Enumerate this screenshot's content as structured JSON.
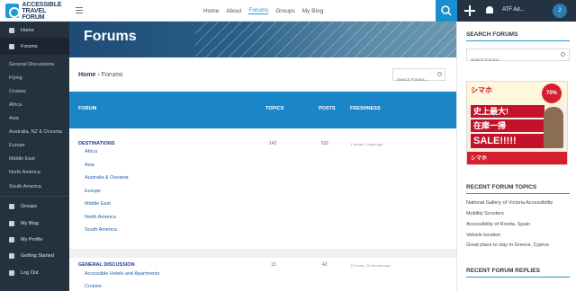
{
  "brand": {
    "name_line1": "ACCESSIBLE",
    "name_line2": "TRAVEL FORUM"
  },
  "topnav": {
    "home": "Home",
    "about": "About",
    "forums": "Forums",
    "groups": "Groups",
    "myblog": "My Blog"
  },
  "account": {
    "user_name": "ATF Ad...",
    "avatar_badge": "2"
  },
  "sidebar": {
    "home": "Home",
    "forums": "Forums",
    "sub": [
      "General Discussions",
      "Flying",
      "Cruises",
      "Africa",
      "Asia",
      "Australia, NZ & Oceania",
      "Europe",
      "Middle East",
      "North America",
      "South America"
    ],
    "groups": "Groups",
    "myblog": "My Blog",
    "myprofile": "My Profile",
    "getting_started": "Getting Started",
    "logout": "Log Out"
  },
  "page": {
    "title": "Forums",
    "breadcrumb_home": "Home",
    "breadcrumb_sep": "›",
    "breadcrumb_current": "Forums",
    "search_placeholder": "Search Forums..."
  },
  "table": {
    "headers": {
      "forum": "FORUM",
      "topics": "TOPICS",
      "posts": "POSTS",
      "freshness": "FRESHNESS"
    },
    "cat1": {
      "title": "DESTINATIONS",
      "topics": "142",
      "posts": "531",
      "freshness": "1 weeks, 2 days ago",
      "forums": [
        "Africa",
        "Asia",
        "Australia & Oceania",
        "Europe",
        "Middle East",
        "North America",
        "South America"
      ]
    },
    "cat2": {
      "title": "GENERAL DISCUSSION",
      "topics": "13",
      "posts": "42",
      "freshness": "11 hours, 21 minutes ago",
      "forums": [
        "Accessible Hotels and Apartments",
        "Cruises"
      ]
    }
  },
  "right": {
    "search_heading": "SEARCH FORUMS",
    "search_placeholder": "Search Forums...",
    "ad": {
      "brand": "シマホ",
      "band1": "史上最大!",
      "band2": "在庫一掃",
      "sale": "SALE!!!!!",
      "badge": "70%",
      "foot": "シマホ"
    },
    "recent_topics_heading": "RECENT FORUM TOPICS",
    "recent_topics": [
      "National Gallery of Victoria Accessibility",
      "Mobility Scooters",
      "Accessibility of Ronda, Spain",
      "Vehicle location",
      "Great place to stay in Greece, Cyprus"
    ],
    "recent_replies_heading": "RECENT FORUM REPLIES"
  },
  "colors": {
    "accent": "#1a86c8",
    "sidebar": "#25313e",
    "hero": "#2b5b86"
  }
}
